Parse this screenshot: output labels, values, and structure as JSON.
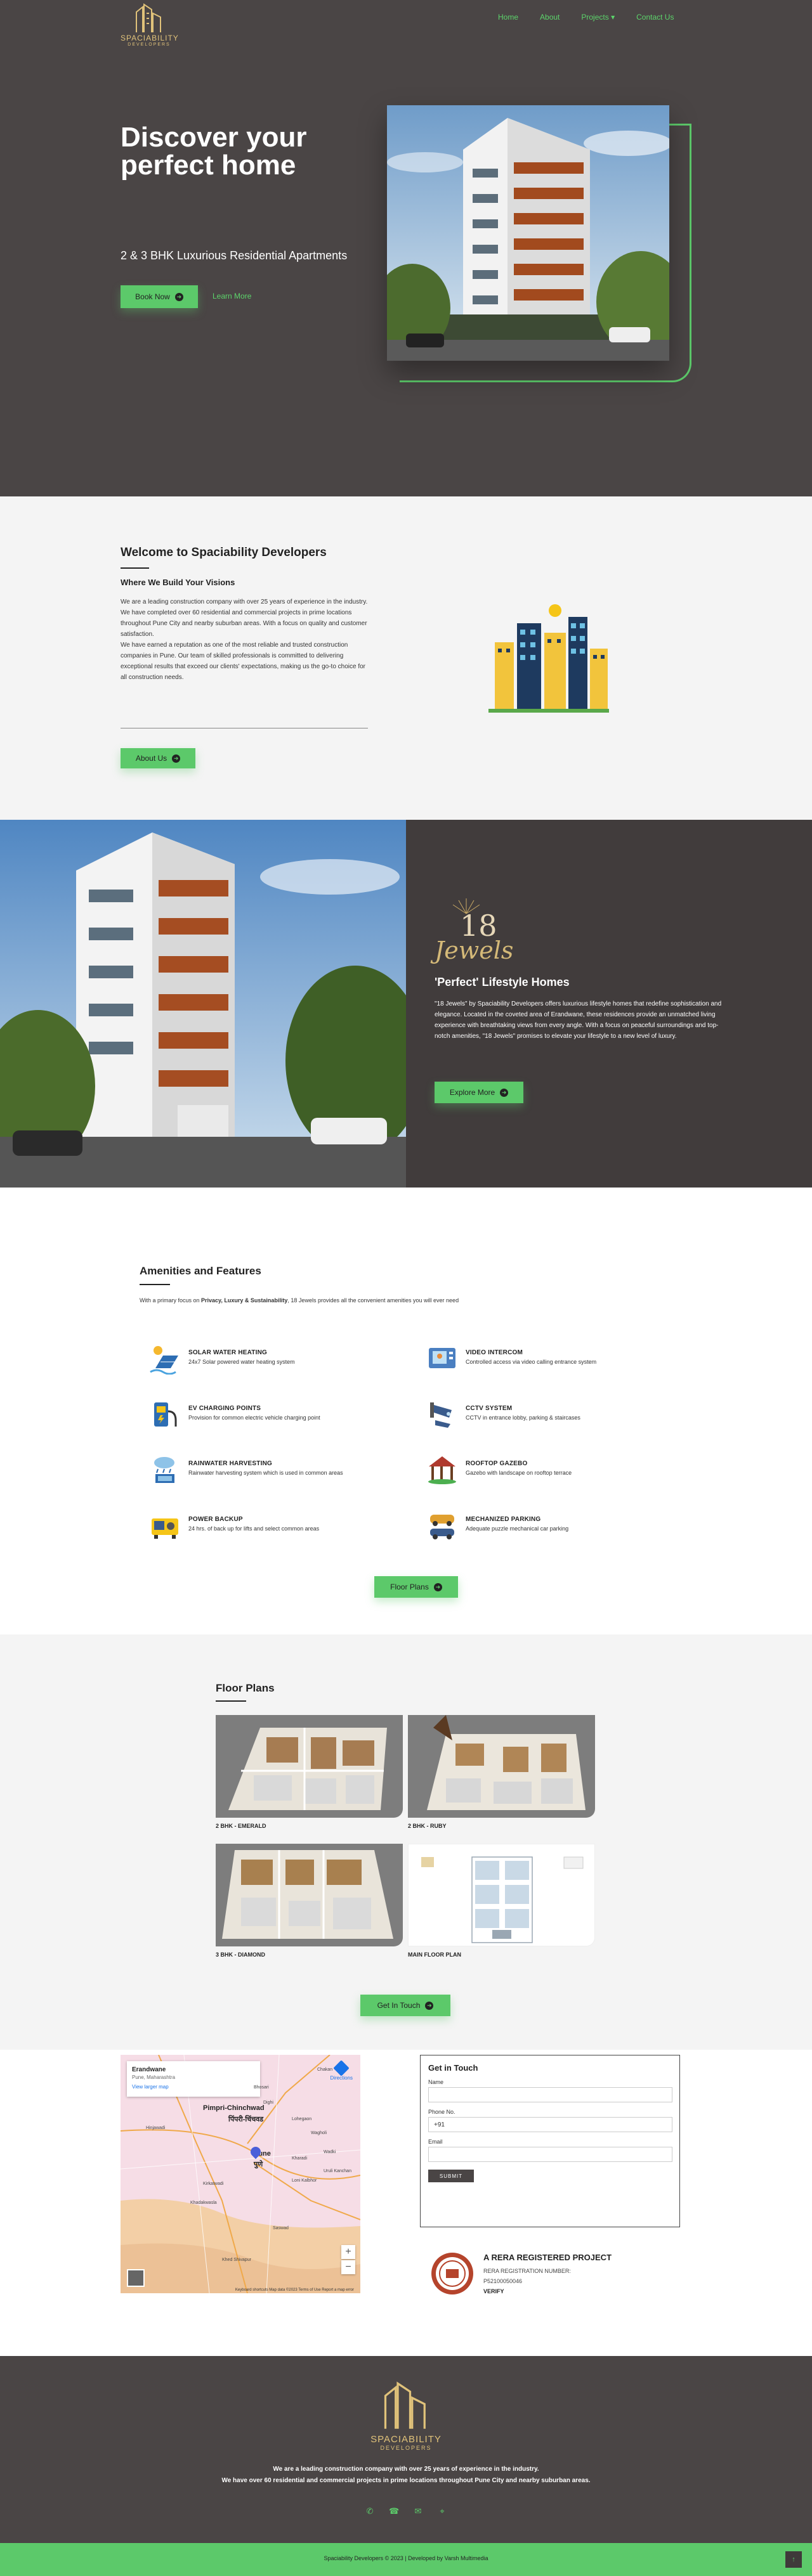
{
  "brand": {
    "logo_text": "SPACIABILITY",
    "logo_sub": "DEVELOPERS"
  },
  "nav": {
    "items": [
      "Home",
      "About",
      "Projects",
      "Contact Us"
    ],
    "projects_caret": "▾"
  },
  "hero": {
    "title": "Discover your perfect home",
    "subtitle": "2 & 3 BHK Luxurious Residential Apartments",
    "book_label": "Book Now",
    "learn_label": "Learn More"
  },
  "welcome": {
    "title": "Welcome to Spaciability Developers",
    "subtitle": "Where We Build Your Visions",
    "paragraphs": [
      "We are a leading construction company with over 25 years of experience in the industry. We have completed over 60 residential and commercial projects in prime locations throughout Pune City and nearby suburban areas. With a focus on quality and customer satisfaction.",
      "We have earned a reputation as one of the most reliable and trusted construction companies in Pune. Our team of skilled professionals is committed to delivering exceptional results that exceed our clients' expectations, making us the go-to choice for all construction needs."
    ],
    "about_label": "About Us"
  },
  "jewels": {
    "logo_number": "18",
    "logo_word": "Jewels",
    "title": "'Perfect' Lifestyle Homes",
    "text": "\"18 Jewels\" by Spaciability Developers offers luxurious lifestyle homes that redefine sophistication and elegance. Located in the coveted area of Erandwane, these residences provide an unmatched living experience with breathtaking views from every angle. With a focus on peaceful surroundings and top-notch amenities, \"18 Jewels\" promises to elevate your lifestyle to a new level of luxury.",
    "button_label": "Explore More"
  },
  "amenities": {
    "title": "Amenities and Features",
    "intro_prefix": "With a primary focus on ",
    "intro_bold": "Privacy, Luxury & Sustainability",
    "intro_suffix": ", 18 Jewels provides all the convenient amenities you will ever need",
    "items": [
      {
        "name": "SOLAR WATER HEATING",
        "desc": "24x7 Solar powered water heating system",
        "icon": "solar-panel-icon"
      },
      {
        "name": "VIDEO INTERCOM",
        "desc": "Controlled access via video calling entrance system",
        "icon": "video-intercom-icon"
      },
      {
        "name": "EV CHARGING POINTS",
        "desc": "Provision for common electric vehicle charging point",
        "icon": "ev-charger-icon"
      },
      {
        "name": "CCTV SYSTEM",
        "desc": "CCTV in entrance lobby, parking & staircases",
        "icon": "cctv-icon"
      },
      {
        "name": "RAINWATER HARVESTING",
        "desc": "Rainwater harvesting system which is used in common areas",
        "icon": "rainwater-icon"
      },
      {
        "name": "ROOFTOP GAZEBO",
        "desc": "Gazebo with landscape on rooftop terrace",
        "icon": "gazebo-icon"
      },
      {
        "name": "POWER BACKUP",
        "desc": "24 hrs. of back up for lifts and select common areas",
        "icon": "generator-icon"
      },
      {
        "name": "MECHANIZED PARKING",
        "desc": "Adequate puzzle mechanical car parking",
        "icon": "parking-icon"
      }
    ],
    "button_label": "Floor Plans"
  },
  "floor": {
    "title": "Floor Plans",
    "plans": [
      "2 BHK - EMERALD",
      "2 BHK - RUBY",
      "3 BHK - DIAMOND",
      "MAIN FLOOR PLAN"
    ],
    "button_label": "Get In Touch"
  },
  "map": {
    "place_title": "Erandwane",
    "place_sub": "Pune, Maharashtra",
    "larger_map": "View larger map",
    "directions": "Directions",
    "city_main": "Pimpri-Chinchwad",
    "city_main_marathi": "पिंपरी-चिंचवड",
    "city_pune": "Pune",
    "city_pune_marathi": "पुणे",
    "labels": [
      "Dighi",
      "Bhosari",
      "Chakan",
      "Wagholi",
      "Hinjawadi",
      "Lohegaon",
      "Wadki",
      "Khadakwasla",
      "Kharadi",
      "Loni Kalbhor",
      "Uruli Kanchan",
      "Kirkatwadi",
      "Saswad",
      "Khed Shivapur"
    ],
    "footer": "Keyboard shortcuts   Map data ©2023   Terms of Use   Report a map error",
    "zoom_in": "+",
    "zoom_out": "−"
  },
  "form": {
    "title": "Get in Touch",
    "name_label": "Name",
    "phone_label": "Phone No.",
    "phone_value": "+91",
    "email_label": "Email",
    "submit_label": "SUBMIT"
  },
  "rera": {
    "title": "A RERA REGISTERED PROJECT",
    "reg_label": "RERA REGISTRATION NUMBER:",
    "reg_number": "P52100050046",
    "verify": "VERIFY"
  },
  "footer": {
    "line1": "We are a leading construction company with over 25 years of experience in the industry.",
    "line2": "We have over 60 residential and commercial projects in prime locations throughout Pune City and nearby suburban areas.",
    "copyright": "Spaciability Developers © 2023 | Developed by Varsh Multimedia",
    "back_top": "↑"
  },
  "colors": {
    "accent": "#5cc96a",
    "dark": "#4a4545",
    "gold": "#e0c27a"
  }
}
